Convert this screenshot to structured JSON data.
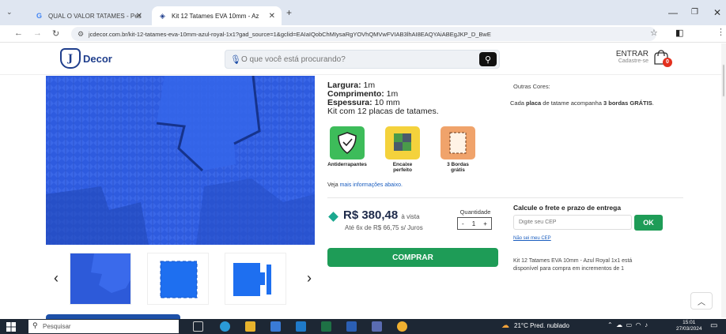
{
  "browser": {
    "tabs": [
      {
        "label": "QUAL O VALOR TATAMES - Pes",
        "favicon": "google-icon"
      },
      {
        "label": "Kit 12 Tatames EVA 10mm - Az",
        "favicon": "jcdecor-icon"
      }
    ],
    "url": "jcdecor.com.br/kit-12-tatames-eva-10mm-azul-royal-1x1?gad_source=1&gclid=EAIaIQobChMIysaRgYOVhQMVwFVIAB3lhAI8EAQYAiABEgJKP_D_BwE"
  },
  "header": {
    "logo_text": "Decor",
    "search_placeholder": "O que você está procurando?",
    "login_label": "ENTRAR",
    "signup_label": "Cadastre-se",
    "cart_count": "0"
  },
  "specs": [
    {
      "label": "Largura:",
      "value": "1m"
    },
    {
      "label": "Comprimento:",
      "value": "1m"
    },
    {
      "label": "Espessura:",
      "value": "10 mm"
    }
  ],
  "kit_text": "Kit com 12 placas de tatames.",
  "features": [
    {
      "label_line1": "Antiderrapantes",
      "label_line2": "",
      "color": "#3dbc5a"
    },
    {
      "label_line1": "Encaixe",
      "label_line2": "perfeito",
      "color": "#f4d23c"
    },
    {
      "label_line1": "3 Bordas",
      "label_line2": "grátis",
      "color": "#f0a36b"
    }
  ],
  "more_info": {
    "prefix": "Veja ",
    "link": "mais informações abaixo."
  },
  "other_colors": "Outras Cores:",
  "bordas_text": {
    "prefix": "Cada ",
    "b1": "placa",
    "mid": " de tatame acompanha ",
    "b2": "3 bordas GRÁTIS",
    "suffix": "."
  },
  "price": {
    "value": "R$ 380,48",
    "suffix": "à vista",
    "installments": "Até 6x de R$ 66,75 s/ Juros"
  },
  "quantity": {
    "label": "Quantidade",
    "minus": "-",
    "value": "1",
    "plus": "+"
  },
  "buy_label": "COMPRAR",
  "shipping": {
    "title": "Calcule o frete e prazo de entrega",
    "placeholder": "Digite seu CEP",
    "ok_label": "OK",
    "dont_know": "Não sei meu CEP"
  },
  "availability": "Kit 12 Tatames EVA 10mm - Azul Royal 1x1 está disponível para compra em incrementos de 1",
  "taskbar": {
    "search_placeholder": "Pesquisar",
    "weather": "21°C  Pred. nublado",
    "time": "15:01",
    "date": "27/03/2024"
  },
  "colors": {
    "brand": "#1f3e8c",
    "buy": "#1e9c57",
    "accent": "#1ba88f"
  }
}
